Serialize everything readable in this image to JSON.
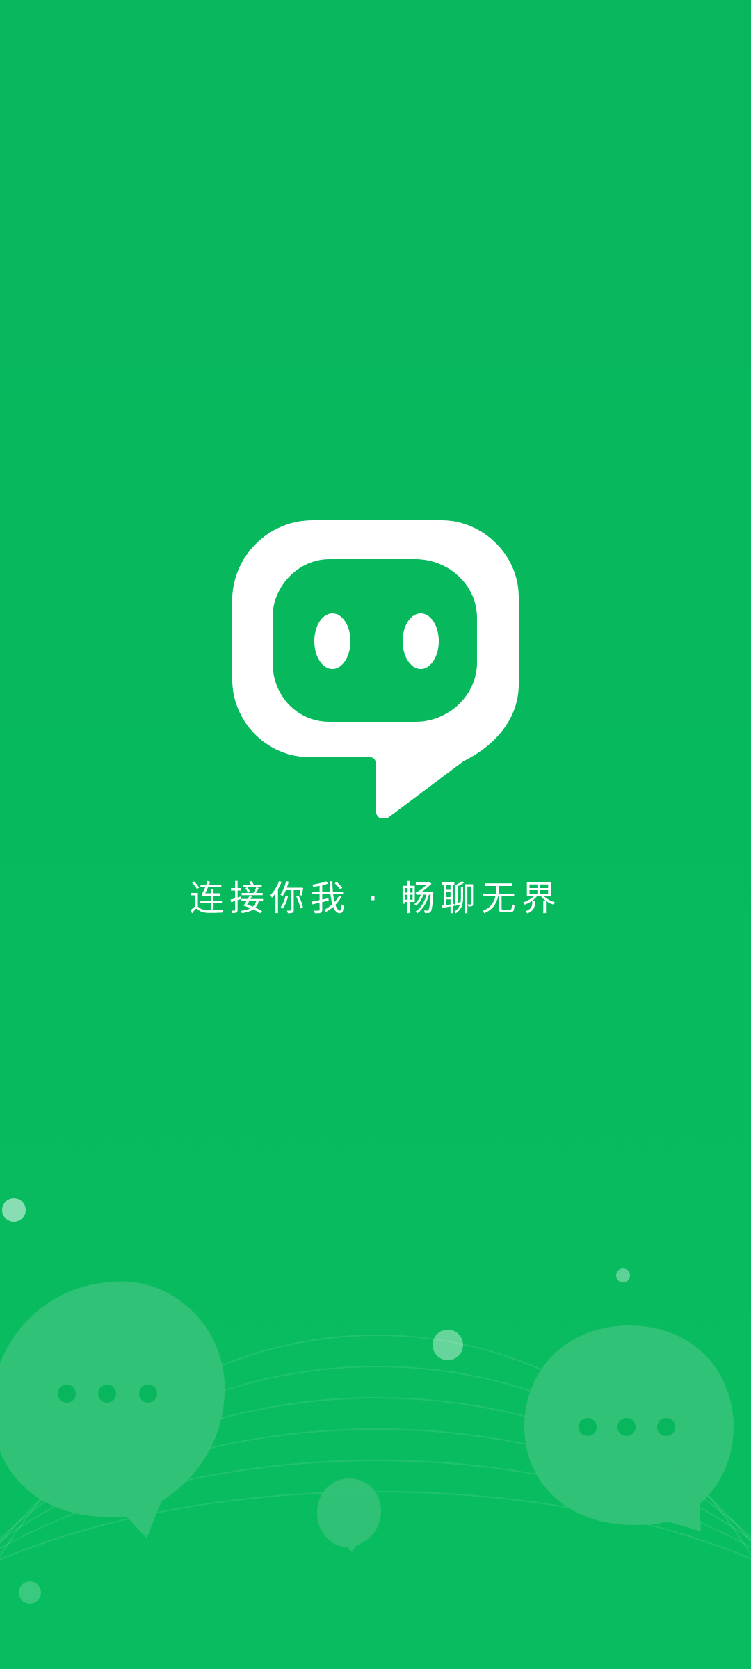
{
  "splash": {
    "tagline": "连接你我 · 畅聊无界",
    "logo_icon": "chat-bubble-face-icon",
    "decoration_icons": [
      "typing-chat-bubble-icon",
      "small-chat-bubble-icon",
      "decorative-dot-icon"
    ]
  },
  "colors": {
    "background": "#07b95d",
    "logo": "#ffffff",
    "tagline": "#ffffff",
    "decor_bubble": "#34c27a"
  }
}
